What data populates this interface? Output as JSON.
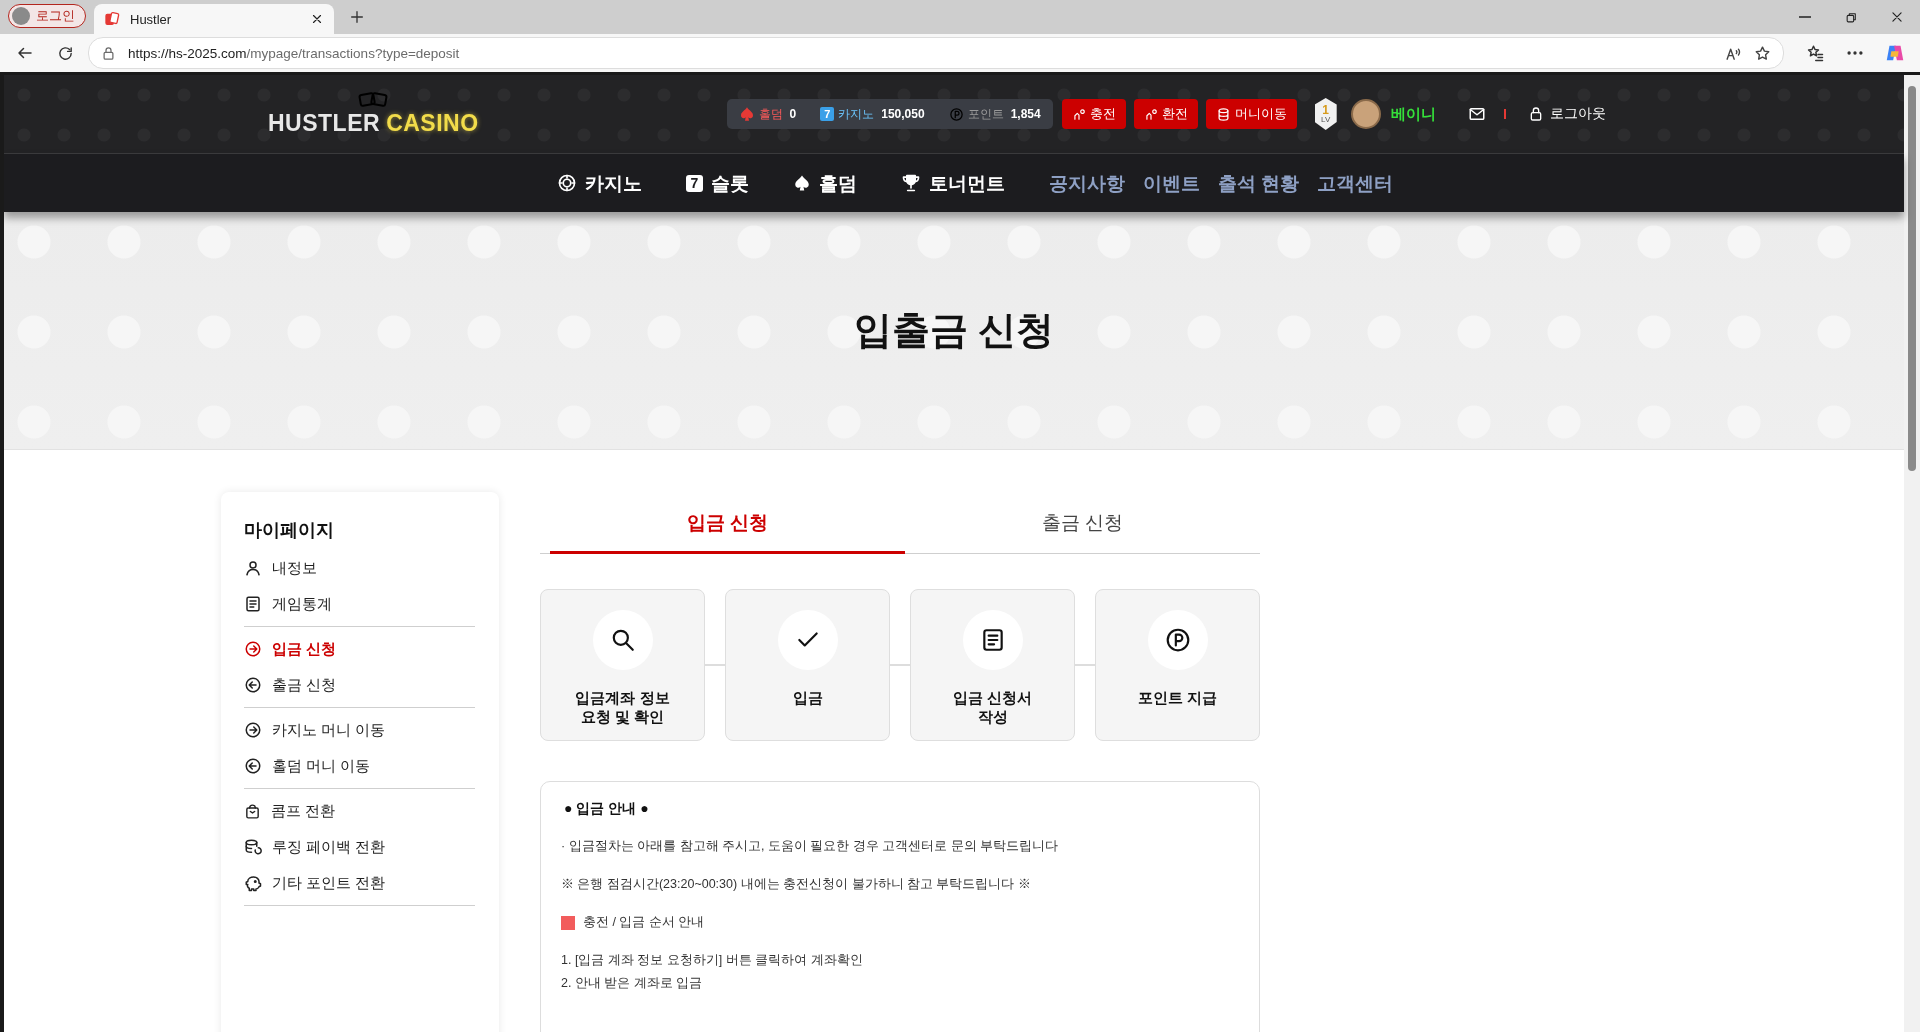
{
  "browser": {
    "profile_label": "로그인",
    "tab_title": "Hustler",
    "url_host": "https://hs-2025.com",
    "url_path": "/mypage/transactions?type=deposit"
  },
  "header": {
    "logo": {
      "word1": "HUSTLER",
      "word2": "CASINO"
    },
    "balances": [
      {
        "kind": "holdem",
        "label": "홀덤",
        "value": "0"
      },
      {
        "kind": "casino",
        "badge": "7",
        "label": "카지노",
        "value": "150,050"
      },
      {
        "kind": "point",
        "label": "포인트",
        "value": "1,854"
      }
    ],
    "actions": [
      {
        "kind": "deposit",
        "label": "충전"
      },
      {
        "kind": "withdraw",
        "label": "환전"
      },
      {
        "kind": "transfer",
        "label": "머니이동"
      }
    ],
    "level": {
      "number": "1",
      "label": "LV"
    },
    "username": "베이니",
    "logout": "로그아웃"
  },
  "nav": [
    {
      "kind": "casino",
      "label": "카지노"
    },
    {
      "kind": "slot",
      "badge": "7",
      "label": "슬롯"
    },
    {
      "kind": "holdem",
      "label": "홀덤"
    },
    {
      "kind": "tournament",
      "label": "토너먼트"
    },
    {
      "kind": "link",
      "label": "공지사항"
    },
    {
      "kind": "link",
      "label": "이벤트"
    },
    {
      "kind": "link",
      "label": "출석 현황"
    },
    {
      "kind": "link",
      "label": "고객센터"
    }
  ],
  "hero": {
    "title": "입출금 신청"
  },
  "sidebar": {
    "title": "마이페이지",
    "groups": [
      {
        "items": [
          {
            "kind": "profile",
            "label": "내정보",
            "selected": false
          },
          {
            "kind": "stats",
            "label": "게임통계",
            "selected": false
          }
        ]
      },
      {
        "items": [
          {
            "kind": "in",
            "label": "입금 신청",
            "selected": true
          },
          {
            "kind": "out",
            "label": "출금 신청",
            "selected": false
          }
        ]
      },
      {
        "items": [
          {
            "kind": "in",
            "label": "카지노 머니 이동",
            "selected": false
          },
          {
            "kind": "out",
            "label": "홀덤 머니 이동",
            "selected": false
          }
        ]
      },
      {
        "items": [
          {
            "kind": "comp",
            "label": "콤프 전환",
            "selected": false
          },
          {
            "kind": "payback",
            "label": "루징 페이백 전환",
            "selected": false
          },
          {
            "kind": "other",
            "label": "기타 포인트 전환",
            "selected": false
          }
        ]
      }
    ]
  },
  "tabs": [
    {
      "label": "입금 신청",
      "selected": true
    },
    {
      "label": "출금 신청",
      "selected": false
    }
  ],
  "steps": [
    {
      "kind": "account",
      "label": "입금계좌 정보\n요청 및 확인"
    },
    {
      "kind": "deposit",
      "label": "입금"
    },
    {
      "kind": "form",
      "label": "입금 신청서\n작성"
    },
    {
      "kind": "points",
      "label": "포인트 지급"
    }
  ],
  "notice": {
    "title": "● 입금 안내 ●",
    "paragraphs": [
      "· 입금절차는 아래를 참고해 주시고, 도움이 필요한 경우 고객센터로 문의 부탁드립니다",
      "※ 은행 점검시간(23:20~00:30) 내에는 충전신청이 불가하니 참고 부탁드립니다 ※"
    ],
    "section": {
      "title": "충전 / 입금 순서 안내",
      "steps": [
        "1. [입금 계좌 정보 요청하기] 버튼 클릭하여 계좌확인",
        "2. 안내 받은 계좌로 입금"
      ]
    }
  }
}
